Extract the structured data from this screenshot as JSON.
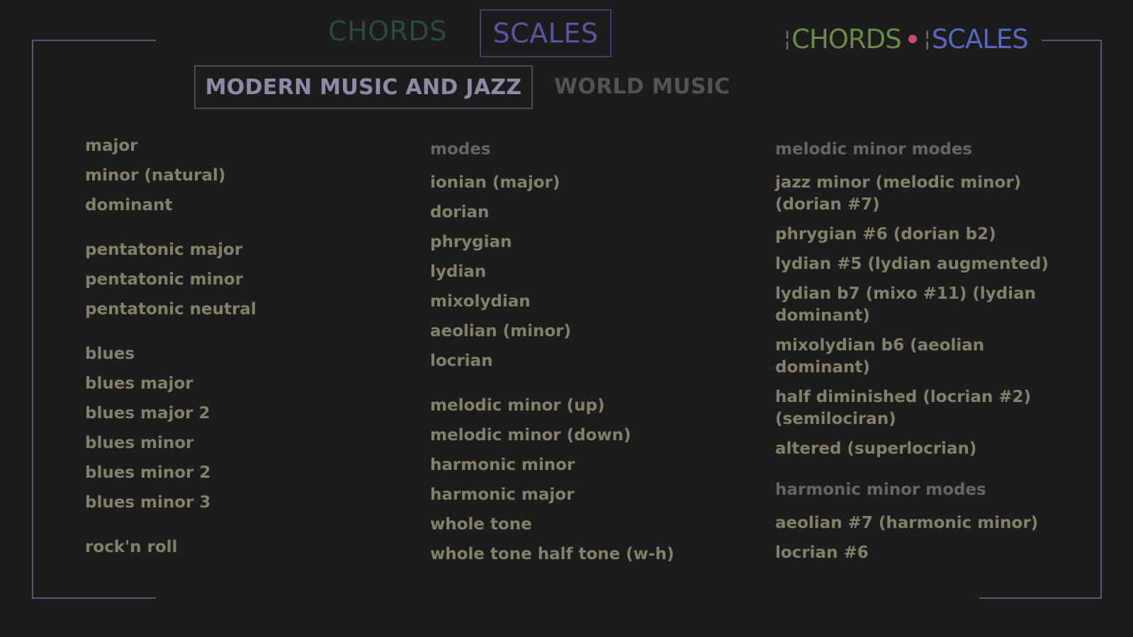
{
  "top_tabs": {
    "chords": "CHORDS",
    "scales": "SCALES"
  },
  "logo": {
    "chords": "CHORDS",
    "scales": "SCALES"
  },
  "sub_tabs": {
    "modern": "MODERN MUSIC AND JAZZ",
    "world": "WORLD MUSIC"
  },
  "columns": {
    "col1": [
      "major",
      "minor (natural)",
      "dominant",
      "pentatonic major",
      "pentatonic minor",
      "pentatonic neutral",
      "blues",
      "blues major",
      "blues major 2",
      "blues minor",
      "blues minor 2",
      "blues minor 3",
      "rock'n roll"
    ],
    "col2": {
      "heading": "modes",
      "items": [
        "ionian (major)",
        "dorian",
        "phrygian",
        "lydian",
        "mixolydian",
        "aeolian (minor)",
        "locrian",
        "melodic minor (up)",
        "melodic minor (down)",
        "harmonic minor",
        "harmonic major",
        "whole tone",
        "whole tone half tone (w-h)"
      ]
    },
    "col3": {
      "heading_melodic": "melodic minor modes",
      "melodic": [
        "jazz minor (melodic minor) (dorian #7)",
        "phrygian #6 (dorian b2)",
        "lydian #5 (lydian augmented)",
        "lydian b7 (mixo #11) (lydian dominant)",
        "mixolydian b6 (aeolian dominant)",
        "half diminished (locrian #2) (semilociran)",
        "altered (superlocrian)"
      ],
      "heading_harmonic": "harmonic minor modes",
      "harmonic": [
        "aeolian #7 (harmonic minor)",
        "locrian #6"
      ]
    }
  }
}
